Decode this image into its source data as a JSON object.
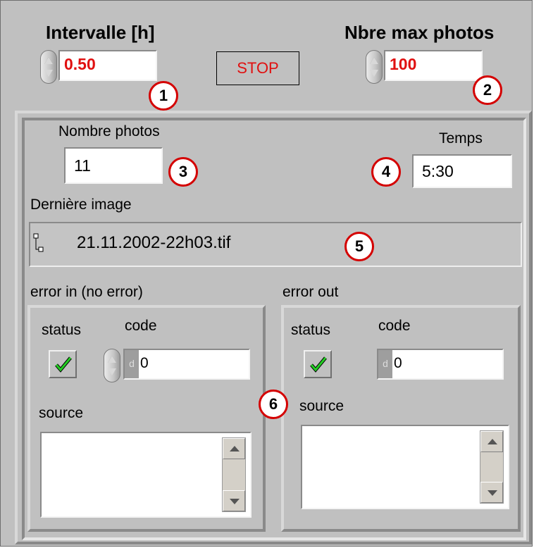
{
  "controls": {
    "interval": {
      "label": "Intervalle [h]",
      "value": "0.50",
      "callout": "1"
    },
    "stop": {
      "label": "STOP"
    },
    "max_photos": {
      "label": "Nbre max photos",
      "value": "100",
      "callout": "2"
    }
  },
  "indicators": {
    "photo_count": {
      "label": "Nombre photos",
      "value": "11",
      "callout": "3"
    },
    "time": {
      "label": "Temps",
      "value": "5:30",
      "callout": "4"
    },
    "last_image": {
      "label": "Dernière image",
      "value": "21.11.2002-22h03.tif",
      "callout": "5"
    }
  },
  "error_in": {
    "title": "error in (no error)",
    "status_label": "status",
    "code_label": "code",
    "code_value": "0",
    "code_prefix": "d",
    "source_label": "source",
    "source_value": ""
  },
  "error_out": {
    "title": "error out",
    "status_label": "status",
    "code_label": "code",
    "code_value": "0",
    "code_prefix": "d",
    "source_label": "source",
    "source_value": ""
  },
  "errors_callout": "6",
  "colors": {
    "panel": "#c0c0c0",
    "control_text": "#e01010",
    "callout_ring": "#d40000",
    "check": "#22cc22"
  },
  "icons": {
    "spinner": "increment-decrement-arrows",
    "path": "path-symbol-icon",
    "status": "green-check-icon"
  }
}
